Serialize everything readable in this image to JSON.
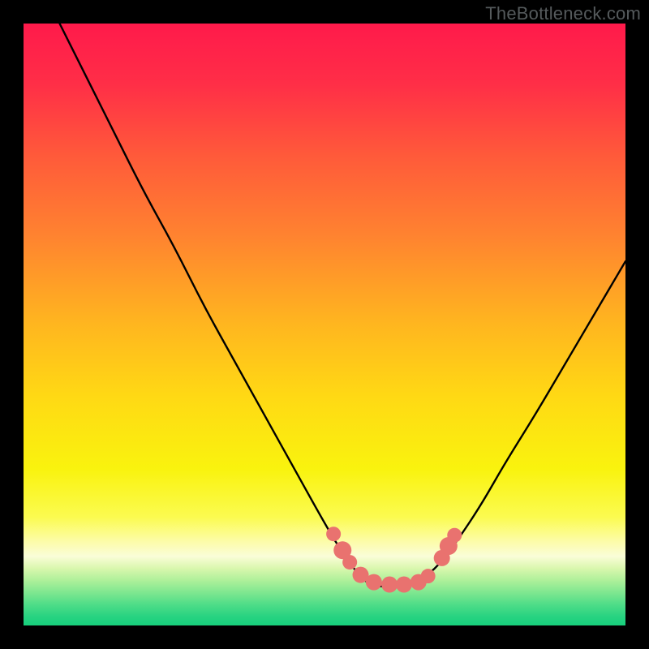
{
  "watermark": "TheBottleneck.com",
  "gradient_stops": [
    {
      "offset": 0.0,
      "color": "#ff1a4b"
    },
    {
      "offset": 0.1,
      "color": "#ff2e47"
    },
    {
      "offset": 0.22,
      "color": "#ff5a3a"
    },
    {
      "offset": 0.35,
      "color": "#ff8230"
    },
    {
      "offset": 0.5,
      "color": "#ffb61f"
    },
    {
      "offset": 0.62,
      "color": "#ffd914"
    },
    {
      "offset": 0.74,
      "color": "#f9f30e"
    },
    {
      "offset": 0.82,
      "color": "#fbfb50"
    },
    {
      "offset": 0.86,
      "color": "#fcfca8"
    },
    {
      "offset": 0.885,
      "color": "#fafdd8"
    },
    {
      "offset": 0.905,
      "color": "#daf7ae"
    },
    {
      "offset": 0.925,
      "color": "#aef09a"
    },
    {
      "offset": 0.945,
      "color": "#7fe790"
    },
    {
      "offset": 0.965,
      "color": "#4fdd88"
    },
    {
      "offset": 0.985,
      "color": "#28d381"
    },
    {
      "offset": 1.0,
      "color": "#17cf7c"
    }
  ],
  "curve": {
    "color": "#000000",
    "width": 2.4
  },
  "markers": {
    "color": "#e9726f",
    "points": [
      {
        "x": 0.515,
        "y": 0.848,
        "r": 9
      },
      {
        "x": 0.53,
        "y": 0.875,
        "r": 11
      },
      {
        "x": 0.542,
        "y": 0.895,
        "r": 9
      },
      {
        "x": 0.56,
        "y": 0.916,
        "r": 10
      },
      {
        "x": 0.582,
        "y": 0.928,
        "r": 10
      },
      {
        "x": 0.608,
        "y": 0.932,
        "r": 10
      },
      {
        "x": 0.632,
        "y": 0.932,
        "r": 10
      },
      {
        "x": 0.656,
        "y": 0.928,
        "r": 10
      },
      {
        "x": 0.672,
        "y": 0.918,
        "r": 9
      },
      {
        "x": 0.695,
        "y": 0.888,
        "r": 10
      },
      {
        "x": 0.706,
        "y": 0.868,
        "r": 11
      },
      {
        "x": 0.716,
        "y": 0.85,
        "r": 9
      }
    ]
  },
  "chart_data": {
    "type": "line",
    "title": "",
    "xlabel": "",
    "ylabel": "",
    "xlim": [
      0,
      1
    ],
    "ylim": [
      0,
      1
    ],
    "series": [
      {
        "name": "bottleneck-curve",
        "x": [
          0.06,
          0.1,
          0.15,
          0.2,
          0.25,
          0.3,
          0.35,
          0.4,
          0.45,
          0.5,
          0.53,
          0.56,
          0.58,
          0.6,
          0.62,
          0.64,
          0.66,
          0.69,
          0.72,
          0.76,
          0.8,
          0.85,
          0.9,
          0.95,
          1.0
        ],
        "y": [
          1.0,
          0.92,
          0.82,
          0.72,
          0.63,
          0.53,
          0.44,
          0.35,
          0.26,
          0.17,
          0.12,
          0.08,
          0.065,
          0.065,
          0.065,
          0.065,
          0.075,
          0.1,
          0.14,
          0.2,
          0.27,
          0.35,
          0.435,
          0.52,
          0.605
        ]
      }
    ],
    "annotations": [
      {
        "text": "TheBottleneck.com",
        "pos": "top-right"
      }
    ]
  }
}
